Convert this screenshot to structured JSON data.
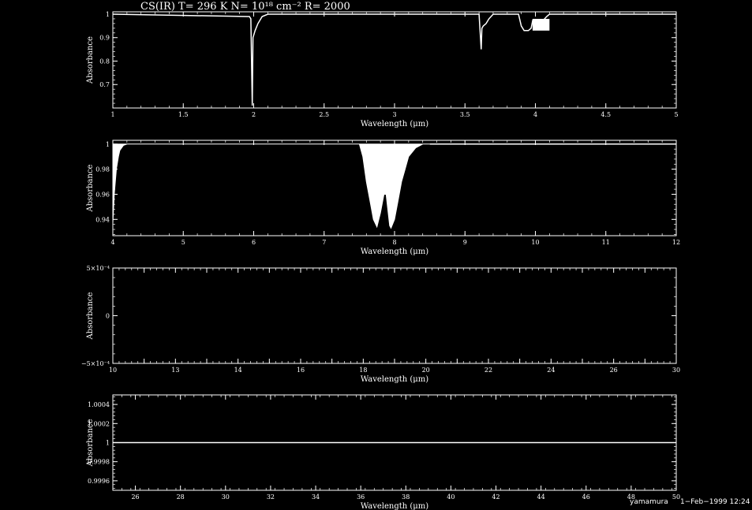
{
  "chart_data": [
    {
      "type": "line",
      "title": "CS(IR) T= 296 K N= 10¹⁸ cm⁻² R= 2000",
      "xlabel": "Wavelength (μm)",
      "ylabel": "Absorbance",
      "xlim": [
        1,
        5
      ],
      "ylim": [
        0.6,
        1.01
      ],
      "xticks": [
        1,
        1.5,
        2,
        2.5,
        3,
        3.5,
        4,
        4.5,
        5
      ],
      "xtick_labels": [
        "1",
        "1.5",
        "2",
        "2.5",
        "3",
        "3.5",
        "4",
        "4.5",
        "5"
      ],
      "yticks": [
        0.7,
        0.8,
        0.9,
        1
      ],
      "ytick_labels": [
        "0.7",
        "0.8",
        "0.9",
        "1"
      ],
      "series": [
        {
          "style": "line",
          "x": [
            1,
            1.97,
            1.98,
            1.99,
            1.995,
            2.0,
            2.01,
            2.03,
            2.06,
            2.1,
            3.6,
            3.61,
            3.615,
            3.62,
            3.63,
            3.65,
            3.67,
            3.7,
            3.88,
            3.9,
            3.92,
            3.95,
            3.97,
            3.98,
            4.0,
            4.03,
            4.05,
            4.08,
            4.1,
            5
          ],
          "y": [
            1,
            0.99,
            0.98,
            0.61,
            0.9,
            0.91,
            0.93,
            0.96,
            0.99,
            1,
            1,
            0.9,
            0.85,
            0.94,
            0.95,
            0.96,
            0.98,
            1,
            1,
            0.95,
            0.93,
            0.93,
            0.94,
            0.97,
            0.94,
            0.96,
            0.97,
            0.99,
            1,
            1
          ]
        },
        {
          "style": "band",
          "x": [
            3.98,
            4.1
          ],
          "y_low": 0.93,
          "y_high": 0.98
        }
      ]
    },
    {
      "type": "line",
      "title": "",
      "xlabel": "Wavelength (μm)",
      "ylabel": "Absorbance",
      "xlim": [
        4,
        12
      ],
      "ylim": [
        0.927,
        1.003
      ],
      "xticks": [
        4,
        5,
        6,
        7,
        8,
        9,
        10,
        11,
        12
      ],
      "xtick_labels": [
        "4",
        "5",
        "6",
        "7",
        "8",
        "9",
        "10",
        "11",
        "12"
      ],
      "yticks": [
        0.94,
        0.96,
        0.98,
        1
      ],
      "ytick_labels": [
        "0.94",
        "0.96",
        "0.98",
        "1"
      ],
      "series": [
        {
          "style": "filled",
          "x": [
            4.0,
            4.02,
            4.05,
            4.08,
            4.1,
            4.15,
            4.2,
            4.3,
            7.5,
            7.55,
            7.6,
            7.65,
            7.7,
            7.75,
            7.8,
            7.85,
            7.88,
            7.9,
            7.93,
            7.95,
            8.0,
            8.05,
            8.1,
            8.15,
            8.2,
            8.3,
            8.4,
            8.5
          ],
          "y": [
            0.937,
            0.96,
            0.98,
            0.99,
            0.995,
            0.999,
            1.0,
            1.0,
            1.0,
            0.99,
            0.97,
            0.955,
            0.94,
            0.934,
            0.945,
            0.96,
            0.96,
            0.95,
            0.935,
            0.933,
            0.94,
            0.955,
            0.97,
            0.98,
            0.99,
            0.997,
            1.0,
            1.0
          ]
        }
      ]
    },
    {
      "type": "line",
      "title": "",
      "xlabel": "Wavelength (μm)",
      "ylabel": "Absorbance",
      "xlim": [
        12,
        30
      ],
      "ylim": [
        -0.0005,
        0.0005
      ],
      "xticks": [
        12,
        13,
        14,
        15,
        16,
        17,
        18,
        19,
        20,
        21,
        22,
        23,
        24,
        25,
        26,
        27,
        28,
        29,
        30
      ],
      "xtick_labels": [
        "10",
        "",
        "13",
        "",
        "14",
        "",
        "16",
        "",
        "18",
        "",
        "20",
        "",
        "22",
        "",
        "24",
        "",
        "26",
        "",
        "30"
      ],
      "yticks": [
        -0.0005,
        0,
        0.0005
      ],
      "ytick_labels": [
        "−5×10⁻⁴",
        "0",
        "5×10⁻⁴"
      ],
      "series": []
    },
    {
      "type": "line",
      "title": "",
      "xlabel": "Wavelength (μm)",
      "ylabel": "Absorbance",
      "xlim": [
        25,
        50
      ],
      "ylim": [
        0.9995,
        1.0005
      ],
      "xticks": [
        26,
        28,
        30,
        32,
        34,
        36,
        38,
        40,
        42,
        44,
        46,
        48,
        50
      ],
      "xtick_labels": [
        "26",
        "28",
        "30",
        "32",
        "34",
        "36",
        "38",
        "40",
        "42",
        "44",
        "46",
        "48",
        "50"
      ],
      "yticks": [
        0.9996,
        0.9998,
        1,
        1.0002,
        1.0004
      ],
      "ytick_labels": [
        "0.9996",
        "0.9998",
        "1",
        "1.0002",
        "1.0004"
      ],
      "series": [
        {
          "style": "line",
          "x": [
            25,
            50
          ],
          "y": [
            1,
            1
          ]
        }
      ]
    }
  ],
  "footer": {
    "author": "yamamura",
    "date": "1−Feb−1999 12:24"
  }
}
